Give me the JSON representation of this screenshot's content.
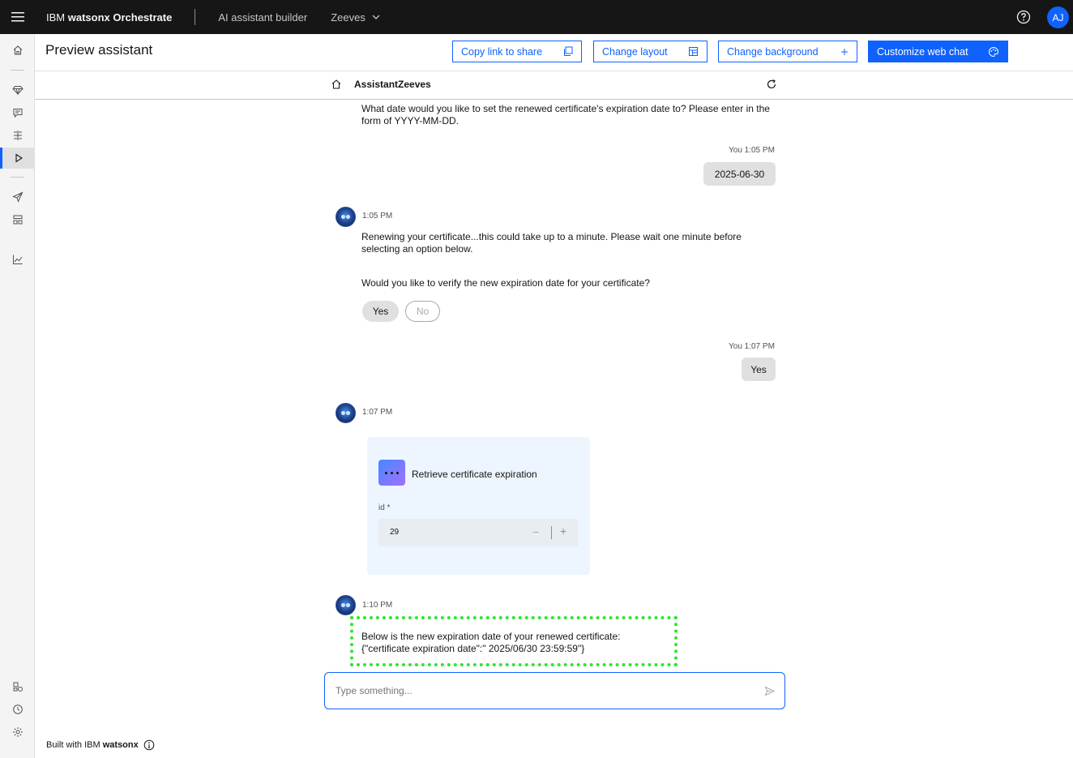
{
  "header": {
    "brand_prefix": "IBM ",
    "brand_strong": "watsonx Orchestrate",
    "section": "AI assistant builder",
    "tenant": "Zeeves",
    "avatar_initials": "AJ"
  },
  "page": {
    "title": "Preview assistant",
    "buttons": {
      "copy_link": "Copy link to share",
      "change_layout": "Change layout",
      "change_background": "Change background",
      "customize": "Customize web chat"
    }
  },
  "chat": {
    "assistant_name": "AssistantZeeves",
    "messages": {
      "m1_text": "What date would you like to set the renewed certificate's expiration date to? Please enter in the form of YYYY-MM-DD.",
      "m2_time": "You 1:05 PM",
      "m2_text": "2025-06-30",
      "m3_time": "1:05 PM",
      "m3_text": "Renewing your certificate...this could take up to a minute. Please wait one minute before selecting an option below.",
      "m3_question": "Would you like to verify the new expiration date for your certificate?",
      "option_yes": "Yes",
      "option_no": "No",
      "m4_time": "You 1:07 PM",
      "m4_text": "Yes",
      "m5_time": "1:07 PM",
      "card_title": "Retrieve certificate expiration",
      "card_field_label": "id *",
      "card_field_value": "29",
      "m6_time": "1:10 PM",
      "m6_line1": "Below is the new expiration date of your renewed certificate:",
      "m6_line2": "{\"certificate expiration date\":\" 2025/06/30 23:59:59\"}"
    },
    "input_placeholder": "Type something..."
  },
  "footer": {
    "prefix": "Built with IBM ",
    "brand": "watsonx"
  },
  "colors": {
    "accent": "#0f62fe",
    "highlight": "#2ee62e"
  }
}
